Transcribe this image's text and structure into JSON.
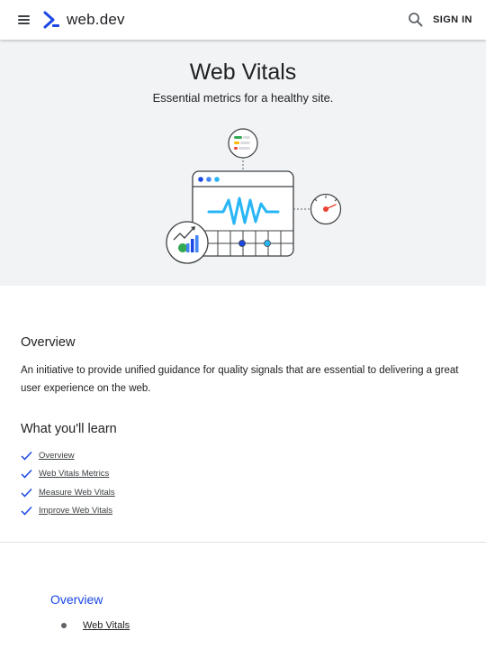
{
  "header": {
    "logo_text": "web.dev",
    "sign_in_label": "SIGN IN"
  },
  "hero": {
    "title": "Web Vitals",
    "subtitle": "Essential metrics for a healthy site."
  },
  "overview": {
    "heading": "Overview",
    "text": "An initiative to provide unified guidance for quality signals that are essential to delivering a great user experience on the web."
  },
  "learn": {
    "heading": "What you'll learn",
    "items": [
      {
        "label": "Overview"
      },
      {
        "label": "Web Vitals Metrics"
      },
      {
        "label": "Measure Web Vitals"
      },
      {
        "label": "Improve Web Vitals"
      }
    ]
  },
  "toc": {
    "title": "Overview",
    "items": [
      {
        "label": "Web Vitals"
      }
    ]
  },
  "colors": {
    "accent": "#1a47e5",
    "hero_bg": "#f1f3f4",
    "wave": "#29b6f6"
  }
}
